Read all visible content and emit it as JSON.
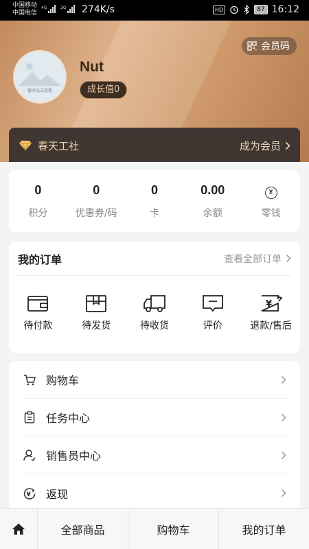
{
  "status_bar": {
    "carrier1": "中国移动",
    "carrier2": "中国电信",
    "net_speed": "274K/s",
    "hd_label": "HD",
    "battery": "87",
    "time": "16:12"
  },
  "profile": {
    "member_code_label": "会员码",
    "nickname": "Nut",
    "growth_label": "成长值0",
    "avatar_caption": "暂时无法查看"
  },
  "vip_bar": {
    "club_name": "春天工社",
    "become_member": "成为会员"
  },
  "assets": [
    {
      "value": "0",
      "label": "积分"
    },
    {
      "value": "0",
      "label": "优惠券/码"
    },
    {
      "value": "0",
      "label": "卡"
    },
    {
      "value": "0.00",
      "label": "余额"
    },
    {
      "value": "",
      "label": "零钱",
      "icon": "yen-icon"
    }
  ],
  "orders": {
    "title": "我的订单",
    "view_all": "查看全部订单",
    "items": [
      {
        "label": "待付款",
        "icon": "wallet-icon"
      },
      {
        "label": "待发货",
        "icon": "box-icon"
      },
      {
        "label": "待收货",
        "icon": "truck-icon"
      },
      {
        "label": "评价",
        "icon": "comment-icon"
      },
      {
        "label": "退款/售后",
        "icon": "refund-icon"
      }
    ]
  },
  "menu": [
    {
      "label": "购物车",
      "icon": "cart-icon"
    },
    {
      "label": "任务中心",
      "icon": "clipboard-icon"
    },
    {
      "label": "销售员中心",
      "icon": "salesperson-icon"
    },
    {
      "label": "返现",
      "icon": "cashback-icon"
    }
  ],
  "bottom_nav": {
    "home_icon": "home-icon",
    "all_products": "全部商品",
    "cart": "购物车",
    "my_orders": "我的订单"
  },
  "colors": {
    "header_gradient_start": "#c18a5d",
    "header_gradient_mid": "#e0b38d",
    "vip_bar_bg": "#3f3631",
    "vip_text": "#f0d2ad"
  }
}
